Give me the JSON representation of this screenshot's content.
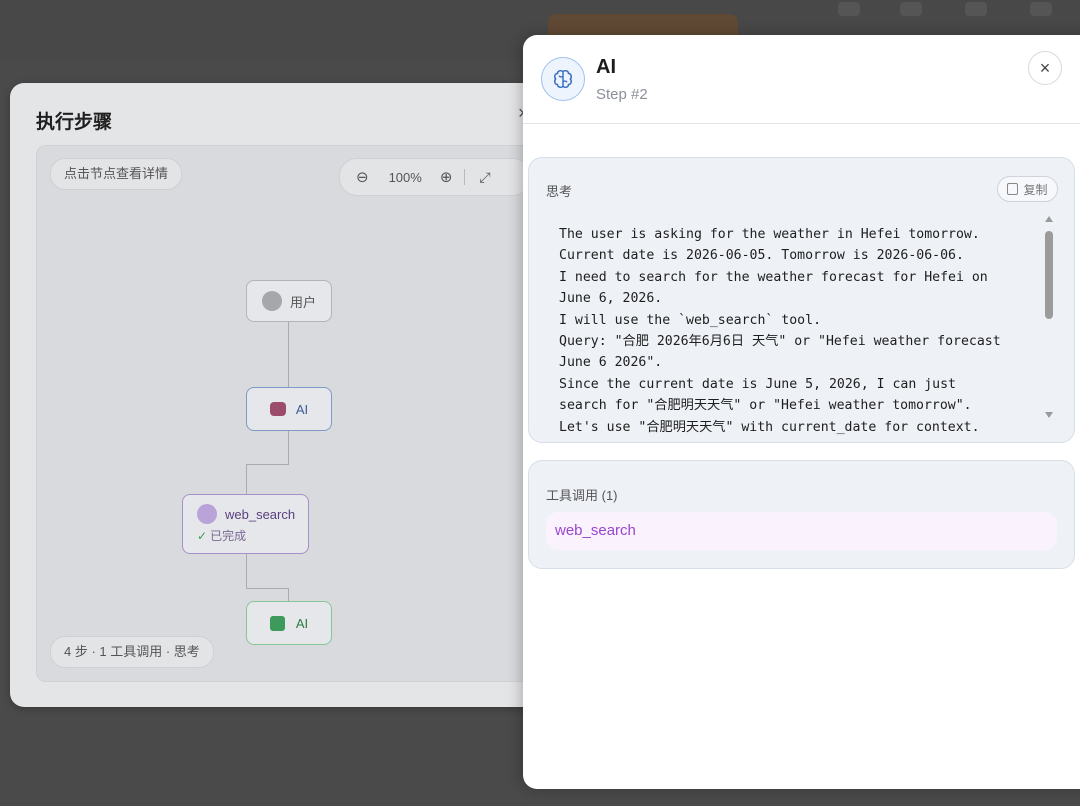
{
  "steps_panel": {
    "title": "执行步骤",
    "close": "×",
    "hint": "点击节点查看详情",
    "zoom": {
      "zoom_out": "⊖",
      "level": "100%",
      "zoom_in": "⊕",
      "fit": "⤢"
    },
    "nodes": {
      "user": "用户",
      "ai_first": "AI",
      "tool_name": "web_search",
      "tool_status": "已完成",
      "tool_status_mark": "✓",
      "ai_final": "AI"
    },
    "summary": "4 步 · 1 工具调用 · 思考"
  },
  "drawer": {
    "title": "AI",
    "subtitle": "Step #2",
    "close": "×",
    "thinking": {
      "label": "思考",
      "copy_label": "复制",
      "text": "The user is asking for the weather in Hefei tomorrow.\nCurrent date is 2026-06-05. Tomorrow is 2026-06-06.\nI need to search for the weather forecast for Hefei on\nJune 6, 2026.\nI will use the `web_search` tool.\nQuery: \"合肥 2026年6月6日 天气\" or \"Hefei weather forecast\nJune 6 2026\".\nSince the current date is June 5, 2026, I can just\nsearch for \"合肥明天天气\" or \"Hefei weather tomorrow\".\nLet's use \"合肥明天天气\" with current_date for context."
    },
    "tools": {
      "label": "工具调用 (1)",
      "items": [
        "web_search"
      ]
    }
  },
  "colors": {
    "accent_blue": "#9ec0ef",
    "tool_purple": "#9a45d0",
    "success_green": "#3e9a5a"
  }
}
